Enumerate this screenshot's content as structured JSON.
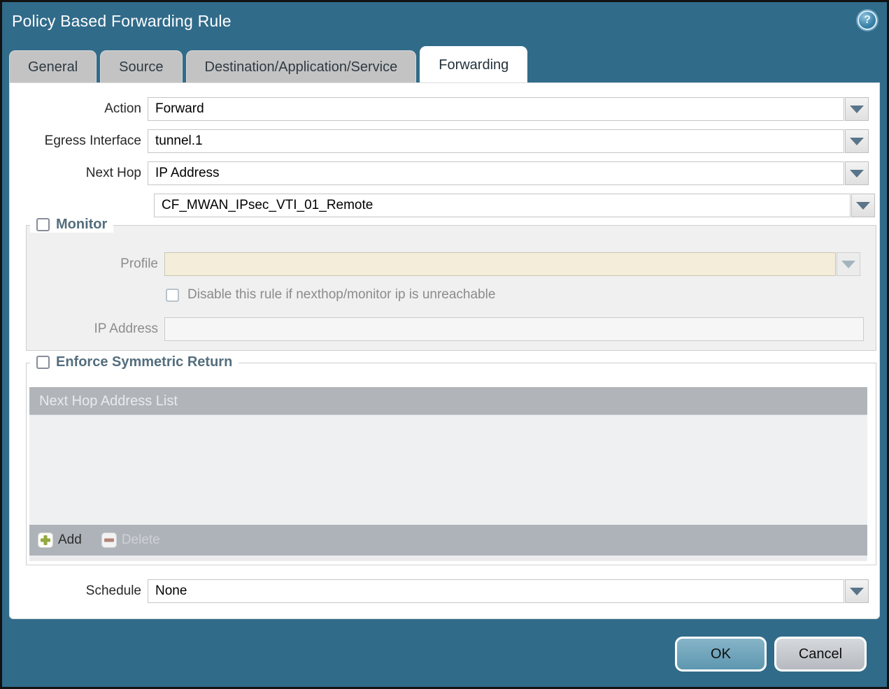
{
  "dialog": {
    "title": "Policy Based Forwarding Rule"
  },
  "tabs": [
    {
      "label": "General",
      "active": false
    },
    {
      "label": "Source",
      "active": false
    },
    {
      "label": "Destination/Application/Service",
      "active": false
    },
    {
      "label": "Forwarding",
      "active": true
    }
  ],
  "form": {
    "action": {
      "label": "Action",
      "value": "Forward"
    },
    "egress_interface": {
      "label": "Egress Interface",
      "value": "tunnel.1"
    },
    "next_hop": {
      "label": "Next Hop",
      "value": "IP Address"
    },
    "next_hop_address": {
      "value": "CF_MWAN_IPsec_VTI_01_Remote"
    },
    "monitor": {
      "legend": "Monitor",
      "checked": false,
      "profile": {
        "label": "Profile",
        "value": "",
        "disabled": true
      },
      "disable_rule": {
        "label": "Disable this rule if nexthop/monitor ip is unreachable",
        "checked": false,
        "disabled": true
      },
      "ip_address": {
        "label": "IP Address",
        "value": "",
        "disabled": true
      }
    },
    "enforce_symmetric_return": {
      "legend": "Enforce Symmetric Return",
      "checked": false,
      "list": {
        "header": "Next Hop Address List",
        "rows": []
      },
      "toolbar": {
        "add_label": "Add",
        "delete_label": "Delete",
        "delete_disabled": true
      }
    },
    "schedule": {
      "label": "Schedule",
      "value": "None"
    }
  },
  "footer": {
    "ok_label": "OK",
    "cancel_label": "Cancel"
  },
  "colors": {
    "titlebar_bg": "#316b8a",
    "ok_button": "#6ba2bb",
    "cancel_button": "#c4c8cd",
    "disabled_field_bg": "#f3edd9",
    "legend_text": "#546e7d",
    "table_header_bg": "#b1b5ba",
    "add_icon_green": "#93a83d",
    "delete_icon_red": "#b5837b",
    "caret_color": "#5a7589"
  }
}
